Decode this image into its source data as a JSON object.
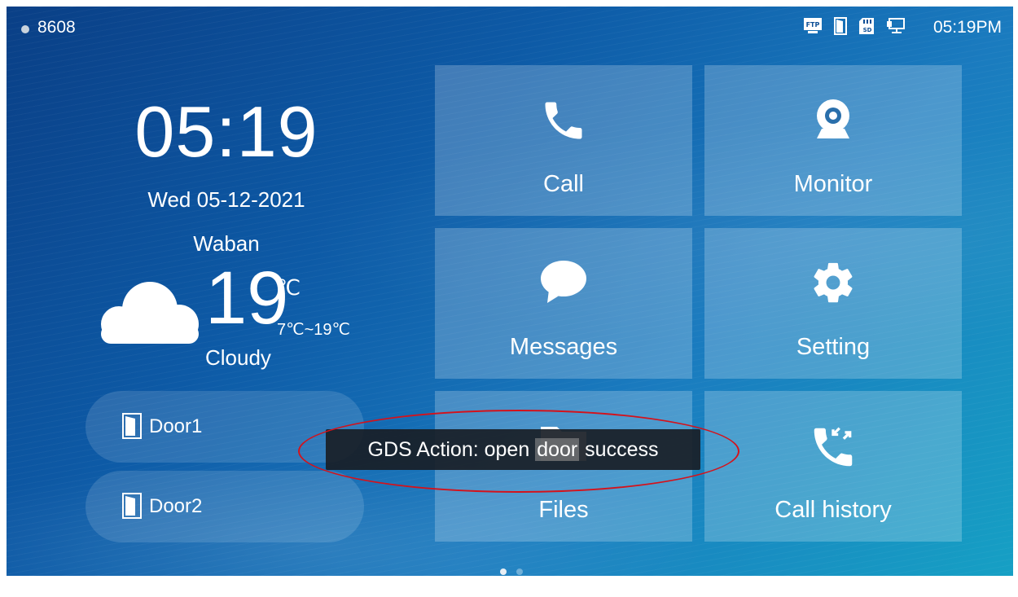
{
  "status_bar": {
    "extension": "8608",
    "time": "05:19PM",
    "icons": [
      "ftp-icon",
      "door-status-icon",
      "sd-card-icon",
      "network-icon"
    ],
    "ftp_text": "FTP",
    "sd_text": "SD"
  },
  "clock": {
    "time": "05:19",
    "date": "Wed  05-12-2021"
  },
  "weather": {
    "city": "Waban",
    "temperature": "19",
    "unit": "℃",
    "range": "7℃~19℃",
    "condition": "Cloudy",
    "icon": "cloud-icon"
  },
  "doors": [
    {
      "label": "Door1",
      "icon": "door-icon"
    },
    {
      "label": "Door2",
      "icon": "door-icon"
    }
  ],
  "tiles": [
    {
      "label": "Call",
      "icon": "phone-icon"
    },
    {
      "label": "Monitor",
      "icon": "webcam-icon"
    },
    {
      "label": "Messages",
      "icon": "chat-bubble-icon"
    },
    {
      "label": "Setting",
      "icon": "gear-icon"
    },
    {
      "label": "Files",
      "icon": "folder-icon"
    },
    {
      "label": "Call history",
      "icon": "call-history-icon"
    }
  ],
  "toast": {
    "before": "GDS Action: open ",
    "highlight": "door",
    "after": " success"
  },
  "pagination": {
    "current": 1,
    "total": 2
  },
  "colors": {
    "background_start": "#0a3f86",
    "background_end": "#16a0c4",
    "tile": "rgba(255,255,255,0.22)",
    "toast_bg": "#191e26",
    "annotation": "#d4121b"
  }
}
